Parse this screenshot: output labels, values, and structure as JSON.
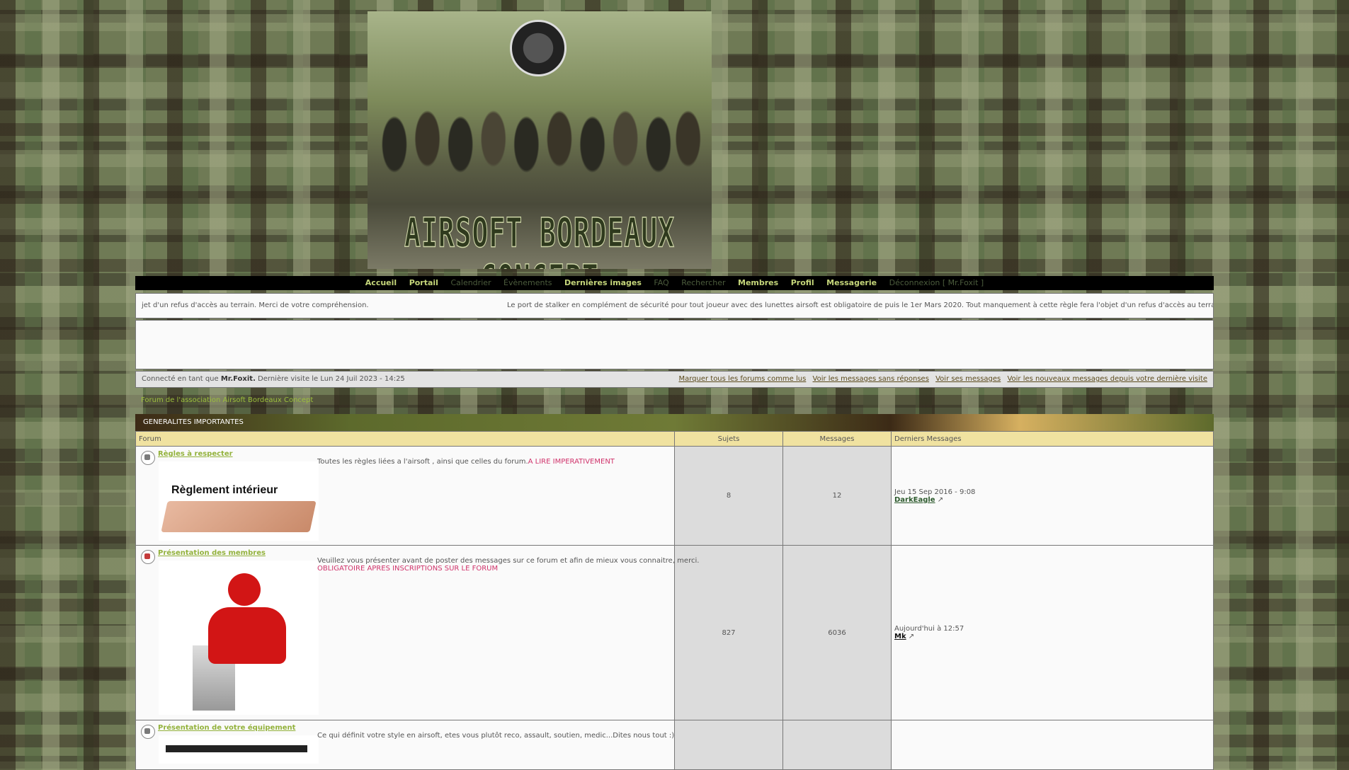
{
  "nav": {
    "items": [
      {
        "label": "Accueil",
        "active": true
      },
      {
        "label": "Portail",
        "active": true
      },
      {
        "label": "Calendrier",
        "active": false
      },
      {
        "label": "Évènements",
        "active": false
      },
      {
        "label": "Dernières images",
        "active": true
      },
      {
        "label": "FAQ",
        "active": false
      },
      {
        "label": "Rechercher",
        "active": false
      },
      {
        "label": "Membres",
        "active": true
      },
      {
        "label": "Profil",
        "active": true
      },
      {
        "label": "Messagerie",
        "active": true
      },
      {
        "label": "Déconnexion [ Mr.Foxit ]",
        "active": false
      }
    ]
  },
  "banner": {
    "logo_text": "AIRSOFT BORDEAUX CONCEPT"
  },
  "marquee": {
    "part1": "jet d'un refus d'accès au terrain. Merci de votre compréhension.",
    "part2": "Le port de stalker en complément de sécurité pour tout joueur avec des lunettes airsoft est obligatoire de puis le 1er Mars 2020. Tout manquement à cette règle fera l'objet d'un refus d'accès au terrain. Merci de votre c"
  },
  "userbar": {
    "connected_prefix": "Connecté en tant que ",
    "username": "Mr.Foxit.",
    "last_visit": " Dernière visite le Lun 24 Juil 2023 - 14:25",
    "links": [
      "Marquer tous les forums comme lus",
      "Voir les messages sans réponses",
      "Voir ses messages",
      "Voir les nouveaux messages depuis votre dernière visite"
    ]
  },
  "forum_link": "Forum de l'association Airsoft Bordeaux Concept",
  "category": {
    "title": "GENERALITES IMPORTANTES",
    "headers": {
      "forum": "Forum",
      "topics": "Sujets",
      "messages": "Messages",
      "last": "Derniers Messages"
    },
    "forums": [
      {
        "title": "Règles à respecter",
        "image_text": "Règlement intérieur",
        "desc": "Toutes les règles liées a l'airsoft , ainsi que celles du forum.",
        "desc_hl": "A LIRE IMPERATIVEMENT",
        "desc2": "",
        "topics": "8",
        "messages": "12",
        "last_date": "Jeu 15 Sep 2016 - 9:08",
        "last_user": "DarkEagle"
      },
      {
        "title": "Présentation des membres",
        "image_text": "",
        "desc": "Veuillez vous présenter avant de poster des messages sur ce forum et afin de mieux vous connaitre, merci.",
        "desc_hl": "",
        "desc2": "OBLIGATOIRE APRES INSCRIPTIONS SUR LE FORUM",
        "topics": "827",
        "messages": "6036",
        "last_date": "Aujourd'hui à 12:57",
        "last_user": "Mk"
      },
      {
        "title": "Présentation de votre équipement",
        "image_text": "",
        "desc": "Ce qui définit votre style en airsoft, etes vous plutôt reco, assault, soutien, medic...Dites nous tout :)",
        "desc_hl": "",
        "desc2": "",
        "topics": "",
        "messages": "",
        "last_date": "",
        "last_user": ""
      }
    ]
  }
}
